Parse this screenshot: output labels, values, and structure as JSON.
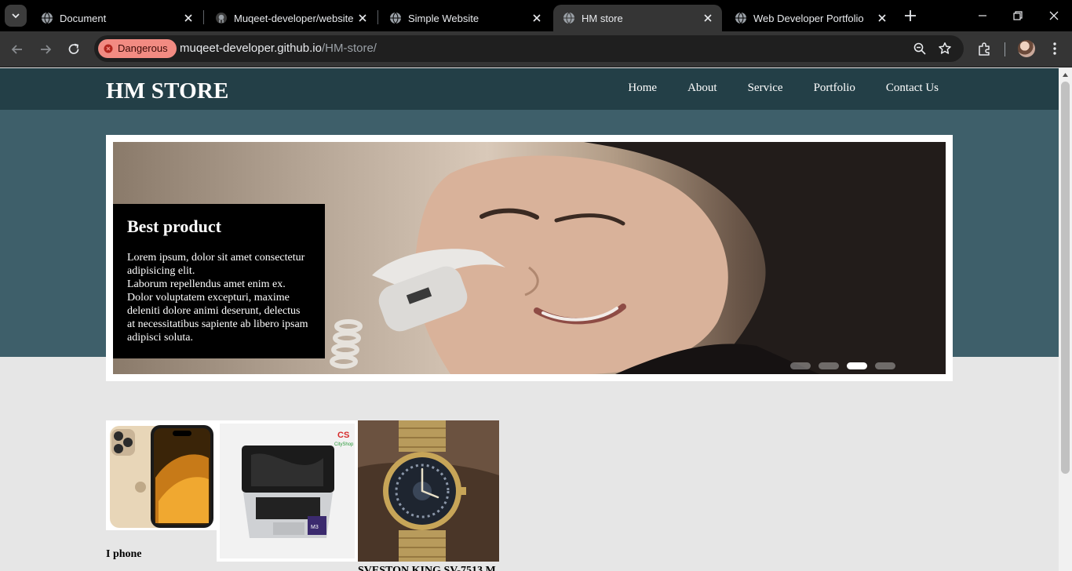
{
  "browser": {
    "tabs": [
      {
        "title": "Document",
        "active": false
      },
      {
        "title": "Muqeet-developer/website",
        "active": false
      },
      {
        "title": "Simple Website",
        "active": false
      },
      {
        "title": "HM store",
        "active": true
      },
      {
        "title": "Web Developer Portfolio",
        "active": false
      }
    ],
    "security_chip": "Dangerous",
    "url_host": "muqeet-developer.github.io",
    "url_path": "/HM-store/"
  },
  "site": {
    "brand": "HM STORE",
    "nav": [
      "Home",
      "About",
      "Service",
      "Portfolio",
      "Contact Us"
    ]
  },
  "hero": {
    "caption_title": "Best product",
    "caption_text": "Lorem ipsum, dolor sit amet consectetur adipisicing elit.\nLaborum repellendus amet enim ex. Dolor voluptatem excepturi, maxime deleniti dolore animi deserunt, delectus at necessitatibus sapiente ab libero ipsam adipisci soluta.",
    "slide_count": 4,
    "active_slide": 3
  },
  "products": [
    {
      "name": "I phone",
      "image": "iphone"
    },
    {
      "name": "",
      "image": "laptop"
    },
    {
      "name": "SVESTON KING SV-7513 M",
      "image": "watch"
    }
  ],
  "colors": {
    "header": "#233f47",
    "hero_band": "#3e5f6a",
    "page_bg": "#e6e6e6",
    "danger": "#f28b82"
  }
}
